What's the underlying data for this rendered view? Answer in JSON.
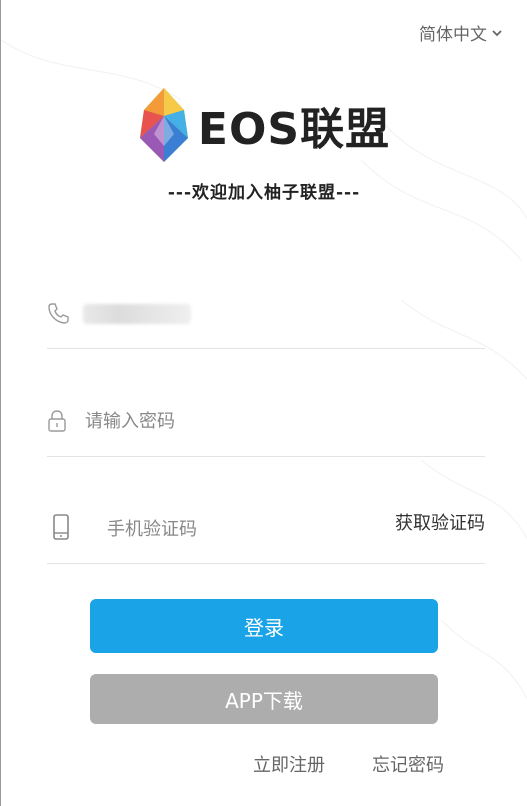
{
  "header": {
    "language": "简体中文"
  },
  "brand": {
    "name": "EOS联盟",
    "tagline": "---欢迎加入柚子联盟---"
  },
  "form": {
    "phone": {
      "icon": "phone-icon"
    },
    "password": {
      "placeholder": "请输入密码",
      "icon": "lock-icon"
    },
    "sms_code": {
      "placeholder": "手机验证码",
      "icon": "mobile-icon",
      "get_code_label": "获取验证码"
    }
  },
  "buttons": {
    "login": "登录",
    "app_download": "APP下载"
  },
  "links": {
    "register": "立即注册",
    "forgot_password": "忘记密码"
  },
  "colors": {
    "primary": "#1aa3e6",
    "secondary_button": "#adadad"
  }
}
